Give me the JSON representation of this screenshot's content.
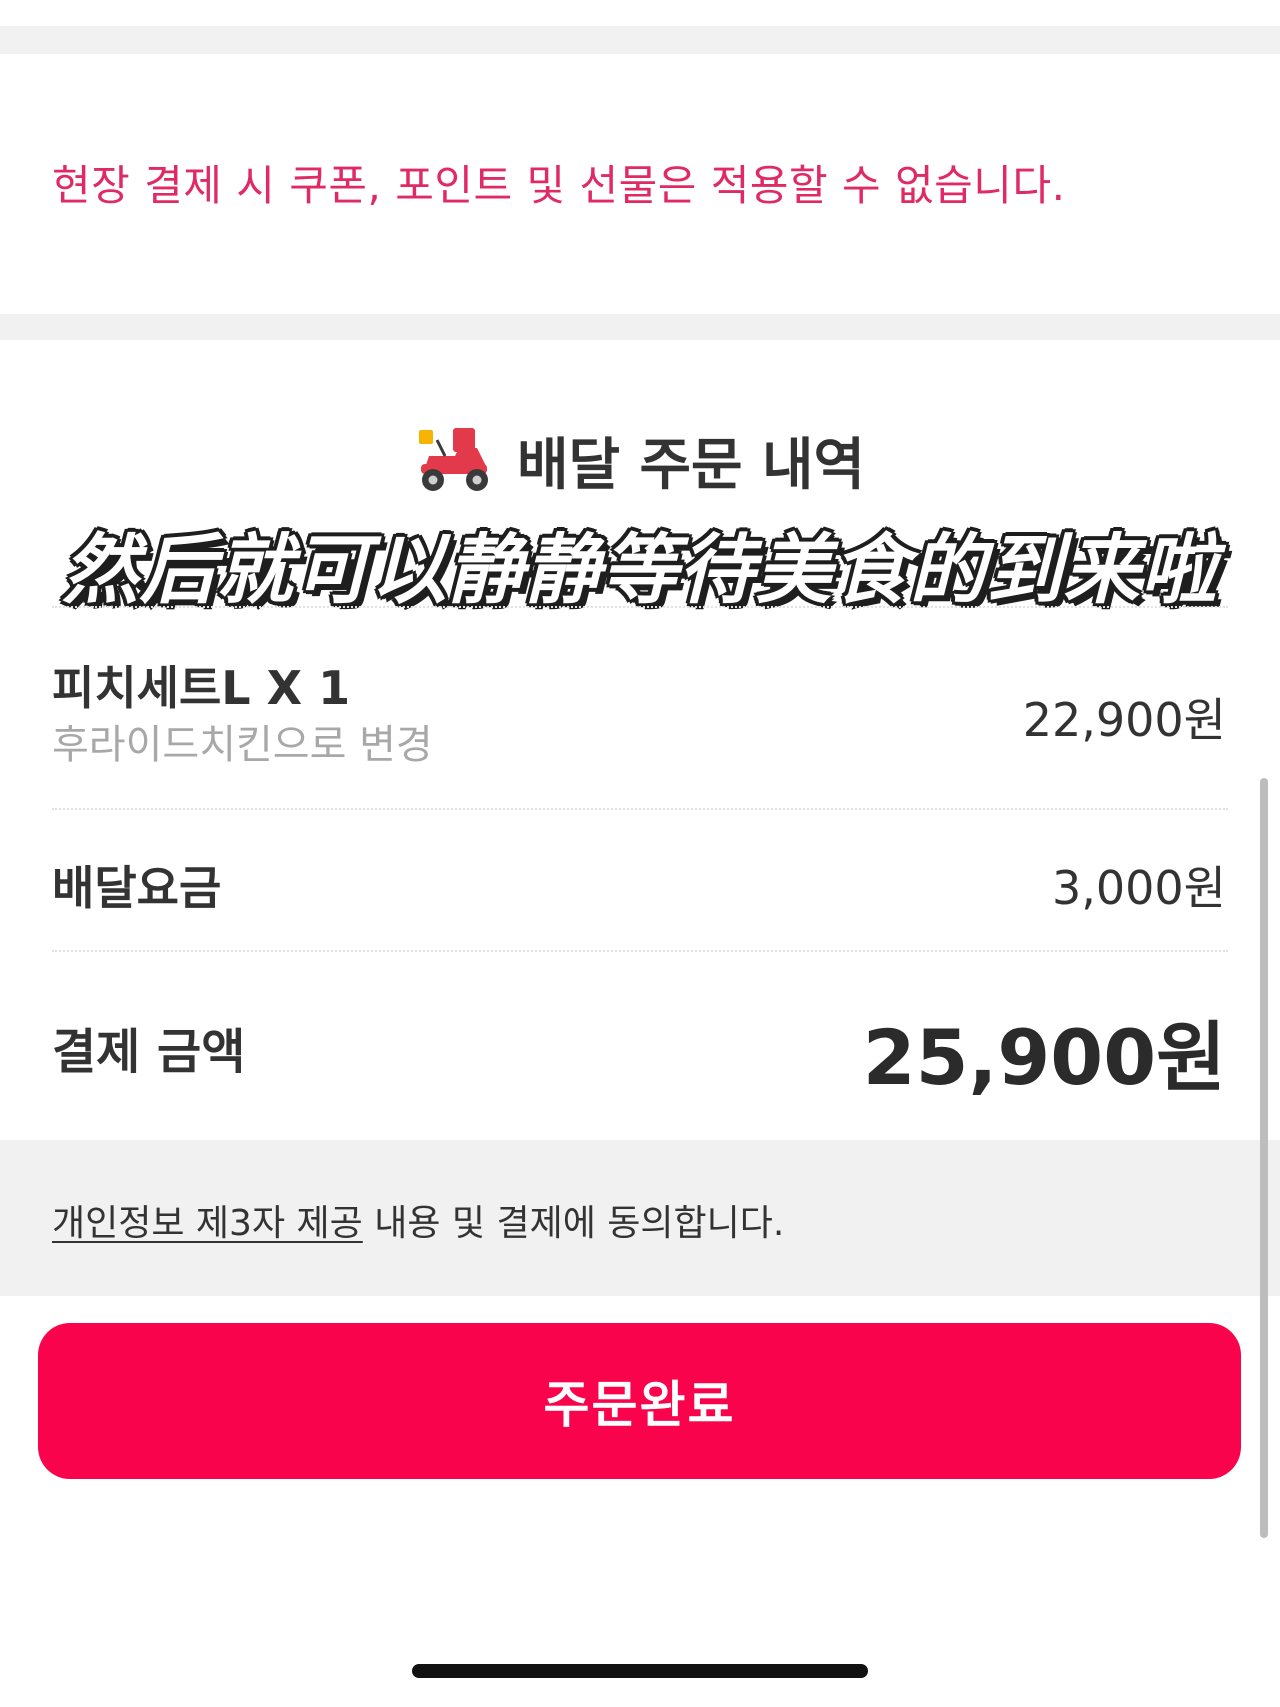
{
  "notice": {
    "text": "현장 결제 시 쿠폰, 포인트 및 선물은 적용할 수 없습니다."
  },
  "section": {
    "icon": "delivery-scooter-icon",
    "title": "배달 주문 내역"
  },
  "caption": "然后就可以静静等待美食的到来啦",
  "order": {
    "item_name": "피치세트L X 1",
    "item_option": "후라이드치킨으로 변경",
    "item_price": "22,900원",
    "delivery_fee_label": "배달요금",
    "delivery_fee": "3,000원",
    "total_label": "결제 금액",
    "total": "25,900원"
  },
  "consent": {
    "link": "개인정보 제3자 제공",
    "text": " 내용 및 결제에 동의합니다."
  },
  "button": {
    "label": "주문완료"
  },
  "colors": {
    "accent": "#f9034c",
    "notice": "#e02a66",
    "band": "#f1f1f1"
  }
}
